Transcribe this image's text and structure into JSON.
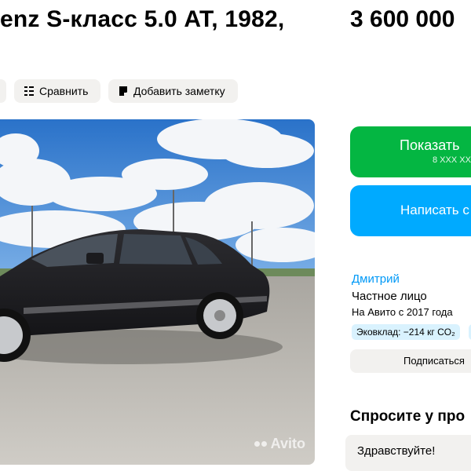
{
  "listing": {
    "title": "enz S-класс 5.0 AT, 1982,",
    "price": "3 600 000"
  },
  "actions": {
    "compare_label": "Сравнить",
    "note_label": "Добавить заметку"
  },
  "photo": {
    "watermark": "Avito"
  },
  "contact": {
    "show_phone_label": "Показать",
    "phone_masked": "8 XXX XX",
    "message_label": "Написать с"
  },
  "seller": {
    "name": "Дмитрий",
    "type": "Частное лицо",
    "since": "На Авито с 2017 года",
    "eco_badge": "Эковклад: −214 кг CO₂",
    "subscribe_label": "Подписаться"
  },
  "ask": {
    "title": "Спросите у про",
    "input_value": "Здравствуйте!"
  },
  "colors": {
    "green": "#04b642",
    "blue": "#00aaff",
    "link": "#0099f7",
    "chip_bg": "#f2f1ef"
  }
}
